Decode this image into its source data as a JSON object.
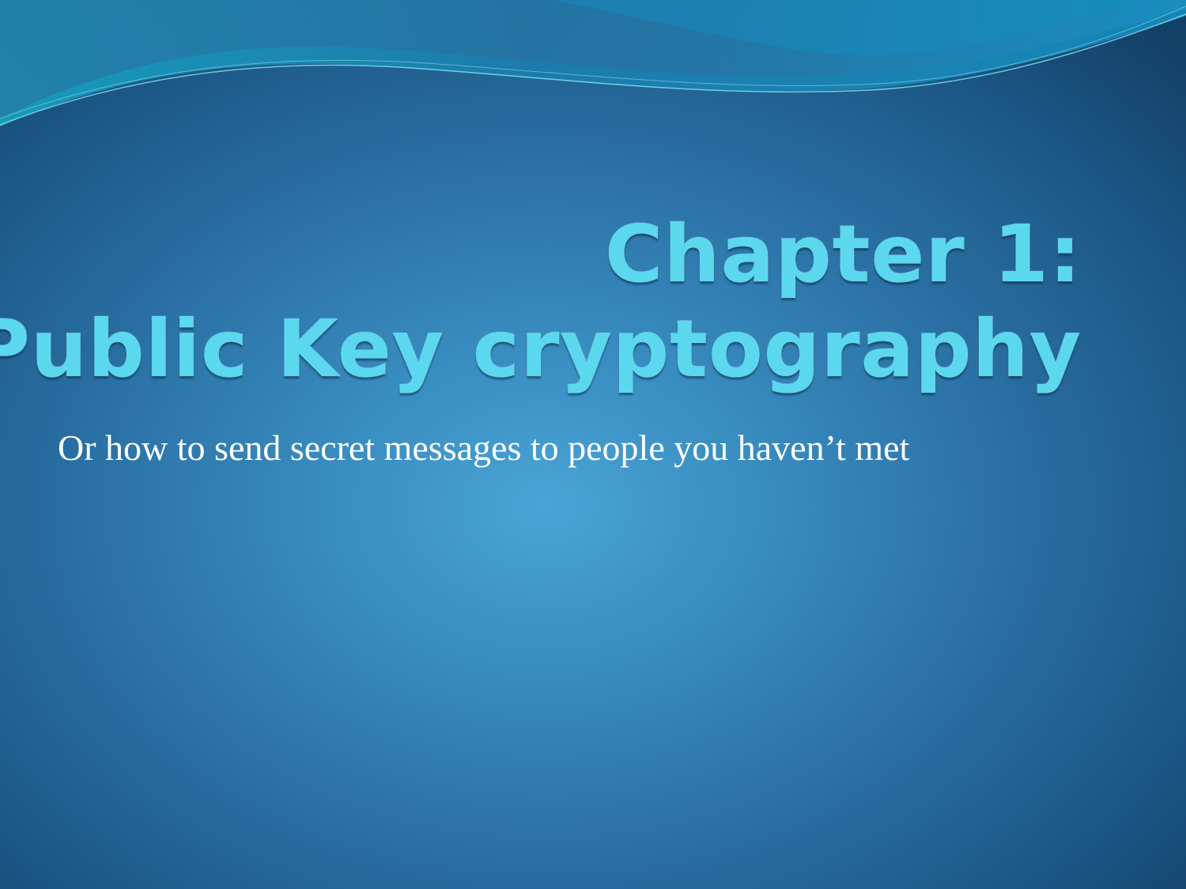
{
  "slide": {
    "title_line1": "Chapter 1:",
    "title_line2": "Public Key cryptography",
    "subtitle": "Or how to send secret messages to people you haven’t met"
  },
  "colors": {
    "background_center": "#4aa3d6",
    "background_edge": "#123f66",
    "title": "#5cd8ee",
    "subtitle": "#ffffff",
    "wave_highlight": "#1fa3c9"
  }
}
